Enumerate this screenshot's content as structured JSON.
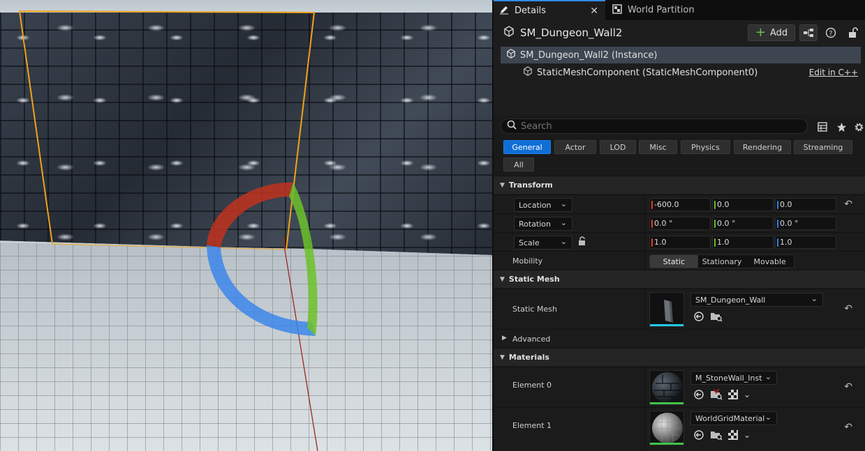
{
  "tabs": [
    {
      "label": "Details",
      "icon": "pencil-icon",
      "active": true
    },
    {
      "label": "World Partition",
      "icon": "grid-icon",
      "active": false
    }
  ],
  "header": {
    "title": "SM_Dungeon_Wall2",
    "add_label": "Add"
  },
  "tree": {
    "instance": "SM_Dungeon_Wall2 (Instance)",
    "component": "StaticMeshComponent (StaticMeshComponent0)",
    "edit_link": "Edit in C++"
  },
  "search": {
    "placeholder": "Search"
  },
  "filters": [
    "General",
    "Actor",
    "LOD",
    "Misc",
    "Physics",
    "Rendering",
    "Streaming",
    "All"
  ],
  "transform": {
    "title": "Transform",
    "location": {
      "label": "Location",
      "x": "-600.0",
      "y": "0.0",
      "z": "0.0"
    },
    "rotation": {
      "label": "Rotation",
      "x": "0.0 °",
      "y": "0.0 °",
      "z": "0.0 °"
    },
    "scale": {
      "label": "Scale",
      "x": "1.0",
      "y": "1.0",
      "z": "1.0"
    },
    "mobility": {
      "label": "Mobility",
      "options": [
        "Static",
        "Stationary",
        "Movable"
      ],
      "selected": "Static"
    }
  },
  "static_mesh": {
    "title": "Static Mesh",
    "label": "Static Mesh",
    "value": "SM_Dungeon_Wall"
  },
  "advanced": {
    "label": "Advanced"
  },
  "materials": {
    "title": "Materials",
    "elements": [
      {
        "label": "Element 0",
        "value": "M_StoneWall_Inst"
      },
      {
        "label": "Element 1",
        "value": "WorldGridMaterial"
      }
    ]
  },
  "colors": {
    "accent_blue": "#0f6fd6",
    "axis_x": "#e0402a",
    "axis_y": "#5fbf2a",
    "axis_z": "#2f7fe6",
    "selection_outline": "#f0a21b"
  }
}
